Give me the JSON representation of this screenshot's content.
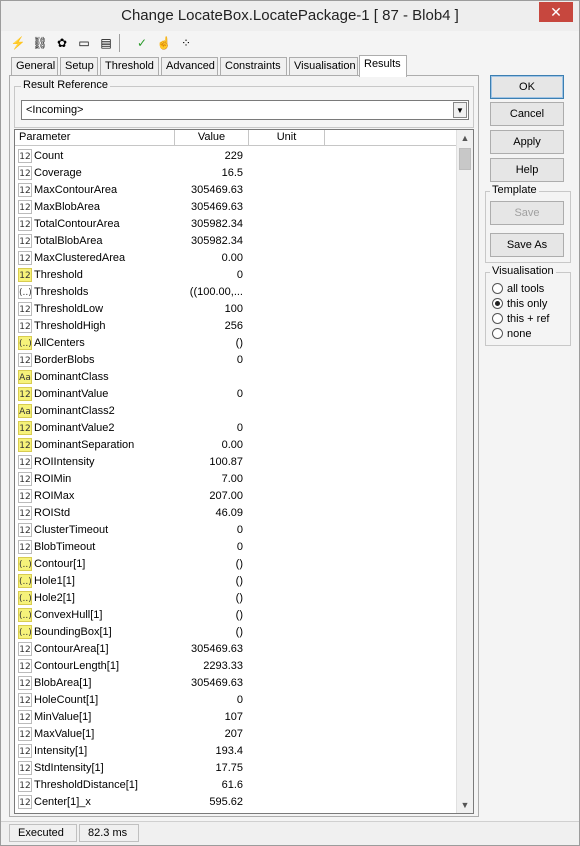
{
  "window": {
    "title": "Change LocateBox.LocatePackage-1 [ 87 - Blob4 ]",
    "close_label": "✕"
  },
  "toolbar": {
    "icons": [
      "lightning-icon",
      "chain-icon",
      "bug-icon",
      "console-icon",
      "document-icon",
      "checkmark-icon",
      "hand-icon",
      "nodes-icon"
    ]
  },
  "tabs": [
    {
      "label": "General"
    },
    {
      "label": "Setup"
    },
    {
      "label": "Threshold"
    },
    {
      "label": "Advanced"
    },
    {
      "label": "Constraints"
    },
    {
      "label": "Visualisation"
    },
    {
      "label": "Results"
    }
  ],
  "active_tab": "Results",
  "result_reference": {
    "label": "Result Reference",
    "value": "<Incoming>"
  },
  "table": {
    "headers": {
      "parameter": "Parameter",
      "value": "Value",
      "unit": "Unit"
    },
    "rows": [
      {
        "icon": "12",
        "hl": false,
        "name": "Count",
        "value": "229"
      },
      {
        "icon": "12",
        "hl": false,
        "name": "Coverage",
        "value": "16.5"
      },
      {
        "icon": "12",
        "hl": false,
        "name": "MaxContourArea",
        "value": "305469.63"
      },
      {
        "icon": "12",
        "hl": false,
        "name": "MaxBlobArea",
        "value": "305469.63"
      },
      {
        "icon": "12",
        "hl": false,
        "name": "TotalContourArea",
        "value": "305982.34"
      },
      {
        "icon": "12",
        "hl": false,
        "name": "TotalBlobArea",
        "value": "305982.34"
      },
      {
        "icon": "12",
        "hl": false,
        "name": "MaxClusteredArea",
        "value": "0.00"
      },
      {
        "icon": "12",
        "hl": true,
        "name": "Threshold",
        "value": "0"
      },
      {
        "icon": "(..)",
        "hl": false,
        "name": "Thresholds",
        "value": "((100.00,..."
      },
      {
        "icon": "12",
        "hl": false,
        "name": "ThresholdLow",
        "value": "100"
      },
      {
        "icon": "12",
        "hl": false,
        "name": "ThresholdHigh",
        "value": "256"
      },
      {
        "icon": "(..)",
        "hl": true,
        "name": "AllCenters",
        "value": "()"
      },
      {
        "icon": "12",
        "hl": false,
        "name": "BorderBlobs",
        "value": "0"
      },
      {
        "icon": "Aa",
        "hl": true,
        "name": "DominantClass",
        "value": ""
      },
      {
        "icon": "12",
        "hl": true,
        "name": "DominantValue",
        "value": "0"
      },
      {
        "icon": "Aa",
        "hl": true,
        "name": "DominantClass2",
        "value": ""
      },
      {
        "icon": "12",
        "hl": true,
        "name": "DominantValue2",
        "value": "0"
      },
      {
        "icon": "12",
        "hl": true,
        "name": "DominantSeparation",
        "value": "0.00"
      },
      {
        "icon": "12",
        "hl": false,
        "name": "ROIIntensity",
        "value": "100.87"
      },
      {
        "icon": "12",
        "hl": false,
        "name": "ROIMin",
        "value": "7.00"
      },
      {
        "icon": "12",
        "hl": false,
        "name": "ROIMax",
        "value": "207.00"
      },
      {
        "icon": "12",
        "hl": false,
        "name": "ROIStd",
        "value": "46.09"
      },
      {
        "icon": "12",
        "hl": false,
        "name": "ClusterTimeout",
        "value": "0"
      },
      {
        "icon": "12",
        "hl": false,
        "name": "BlobTimeout",
        "value": "0"
      },
      {
        "icon": "(..)",
        "hl": true,
        "name": "Contour[1]",
        "value": "()"
      },
      {
        "icon": "(..)",
        "hl": true,
        "name": "Hole1[1]",
        "value": "()"
      },
      {
        "icon": "(..)",
        "hl": true,
        "name": "Hole2[1]",
        "value": "()"
      },
      {
        "icon": "(..)",
        "hl": true,
        "name": "ConvexHull[1]",
        "value": "()"
      },
      {
        "icon": "(..)",
        "hl": true,
        "name": "BoundingBox[1]",
        "value": "()"
      },
      {
        "icon": "12",
        "hl": false,
        "name": "ContourArea[1]",
        "value": "305469.63"
      },
      {
        "icon": "12",
        "hl": false,
        "name": "ContourLength[1]",
        "value": "2293.33"
      },
      {
        "icon": "12",
        "hl": false,
        "name": "BlobArea[1]",
        "value": "305469.63"
      },
      {
        "icon": "12",
        "hl": false,
        "name": "HoleCount[1]",
        "value": "0"
      },
      {
        "icon": "12",
        "hl": false,
        "name": "MinValue[1]",
        "value": "107"
      },
      {
        "icon": "12",
        "hl": false,
        "name": "MaxValue[1]",
        "value": "207"
      },
      {
        "icon": "12",
        "hl": false,
        "name": "Intensity[1]",
        "value": "193.4"
      },
      {
        "icon": "12",
        "hl": false,
        "name": "StdIntensity[1]",
        "value": "17.75"
      },
      {
        "icon": "12",
        "hl": false,
        "name": "ThresholdDistance[1]",
        "value": "61.6"
      },
      {
        "icon": "12",
        "hl": false,
        "name": "Center[1]_x",
        "value": "595.62"
      }
    ]
  },
  "buttons": {
    "ok": "OK",
    "cancel": "Cancel",
    "apply": "Apply",
    "help": "Help"
  },
  "template": {
    "label": "Template",
    "save": "Save",
    "save_as": "Save As"
  },
  "visualisation": {
    "label": "Visualisation",
    "options": [
      {
        "label": "all tools",
        "selected": false
      },
      {
        "label": "this only",
        "selected": true
      },
      {
        "label": "this + ref",
        "selected": false
      },
      {
        "label": "none",
        "selected": false
      }
    ]
  },
  "status": {
    "state": "Executed",
    "time": "82.3 ms"
  },
  "colors": {
    "highlight_icon": "#f6f27a",
    "close_button": "#c7473e",
    "default_button_border": "#3c7fb1"
  }
}
